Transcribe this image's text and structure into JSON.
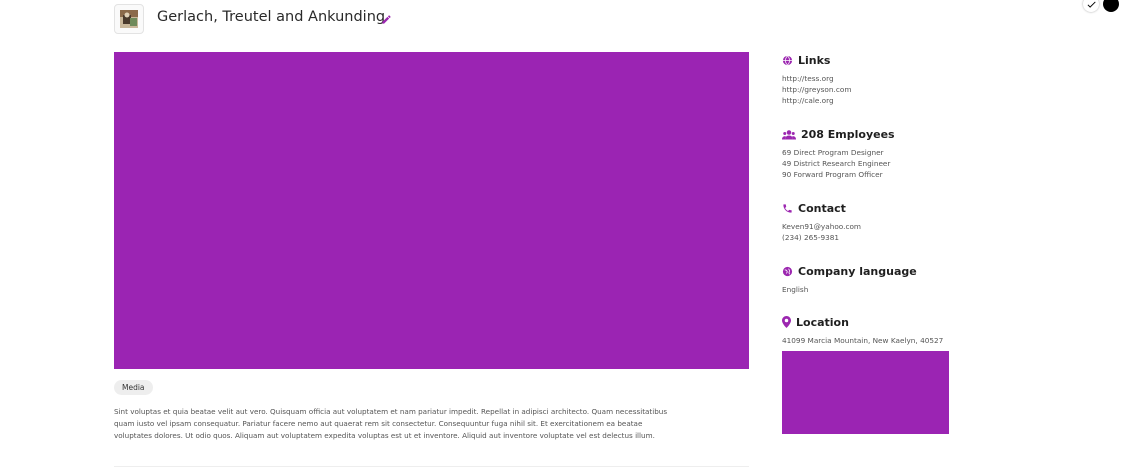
{
  "header": {
    "company_name": "Gerlach, Treutel and Ankunding",
    "edit_icon": "pencil-icon",
    "logo_icon": "company-logo-thumbnail"
  },
  "colors": {
    "accent": "#9c27b0",
    "media_placeholder": "#9b24b3",
    "tag_bg": "#eeeeee"
  },
  "main": {
    "media_tag": "Media",
    "description": "Sint voluptas et quia beatae velit aut vero. Quisquam officia aut voluptatem et nam pariatur impedit. Repellat in adipisci architecto. Quam necessitatibus quam iusto vel ipsam consequatur. Pariatur facere nemo aut quaerat rem sit consectetur. Consequuntur fuga nihil sit. Et exercitationem ea beatae voluptates dolores. Ut odio quos. Aliquam aut voluptatem expedita voluptas est ut et inventore. Aliquid aut inventore voluptate vel est delectus illum."
  },
  "sidebar": {
    "links": {
      "icon": "globe-icon",
      "title": "Links",
      "items": [
        "http://tess.org",
        "http://greyson.com",
        "http://cale.org"
      ]
    },
    "employees": {
      "icon": "users-icon",
      "title": "208 Employees",
      "items": [
        "69 Direct Program Designer",
        "49 District Research Engineer",
        "90 Forward Program Officer"
      ]
    },
    "contact": {
      "icon": "phone-icon",
      "title": "Contact",
      "email": "Keven91@yahoo.com",
      "phone": "(234) 265-9381"
    },
    "language": {
      "icon": "language-icon",
      "title": "Company language",
      "value": "English"
    },
    "location": {
      "icon": "map-pin-icon",
      "title": "Location",
      "address": "41099 Marcia Mountain, New Kaelyn, 40527"
    }
  }
}
